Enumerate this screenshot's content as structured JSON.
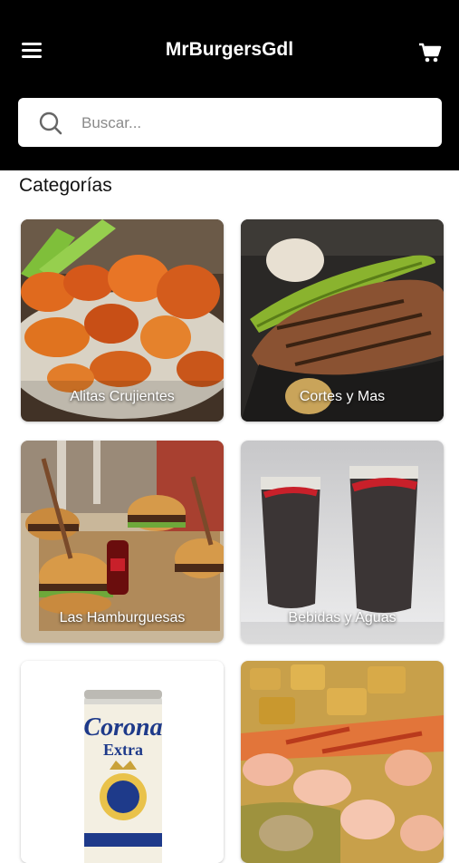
{
  "header": {
    "title": "MrBurgersGdl",
    "menu_icon": "hamburger-menu-icon",
    "cart_icon": "shopping-cart-icon",
    "background": "#000000"
  },
  "search": {
    "placeholder": "Buscar...",
    "value": "",
    "icon": "search-icon"
  },
  "categories": {
    "title": "Categorías",
    "items": [
      {
        "label": "Alitas Crujientes"
      },
      {
        "label": "Cortes y Mas"
      },
      {
        "label": "Las Hamburguesas"
      },
      {
        "label": "Bebidas y Aguas"
      },
      {
        "label": ""
      },
      {
        "label": ""
      }
    ]
  }
}
